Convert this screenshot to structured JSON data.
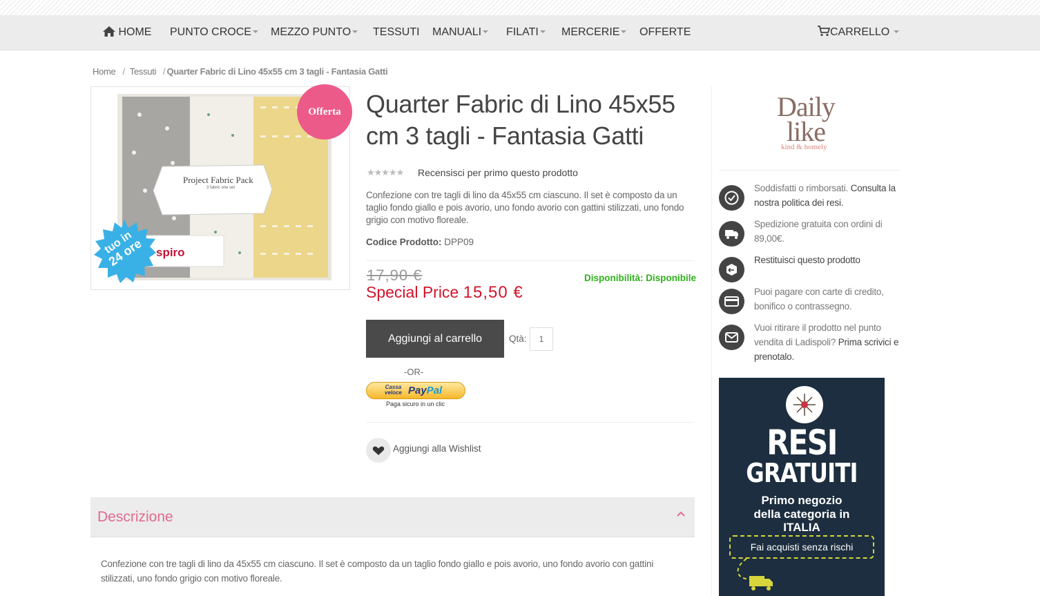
{
  "nav": {
    "home": "HOME",
    "items": [
      "PUNTO CROCE",
      "MEZZO PUNTO",
      "TESSUTI",
      "MANUALI",
      "FILATI",
      "MERCERIE",
      "OFFERTE"
    ],
    "cart": "CARRELLO"
  },
  "breadcrumb": {
    "home": "Home",
    "sep": "/",
    "category": "Tessuti",
    "current": "Quarter Fabric di Lino 45x55 cm 3 tagli - Fantasia Gatti"
  },
  "product": {
    "badge": "Offerta",
    "stamp_line1": "tuo in",
    "stamp_line2": "24 ore",
    "pack_title": "Project Fabric Pack",
    "pack_sub": "3 fabric one set",
    "pack_brand": "spiro",
    "title": "Quarter Fabric di Lino 45x55 cm 3 tagli - Fantasia Gatti",
    "stars": "★★★★★",
    "review_link": "Recensisci per primo questo prodotto",
    "short_description": "Confezione con tre tagli di lino da 45x55 cm ciascuno. Il set è composto da un taglio fondo giallo e pois avorio, uno fondo avorio con gattini stilizzati, uno fondo grigio con motivo floreale.",
    "sku_label": "Codice Prodotto:",
    "sku": "DPP09",
    "old_price": "17,90 €",
    "special_label": "Special Price",
    "special_price": "15,50 €",
    "availability_label": "Disponibilità:",
    "availability": "Disponibile",
    "add_to_cart": "Aggiungi al carrello",
    "qty_label": "Qtà:",
    "qty": "1",
    "or": "-OR-",
    "paypal_cv1": "Cassa",
    "paypal_cv2": "veloce",
    "paypal_a": "Pay",
    "paypal_b": "Pal",
    "paypal_sub": "Paga sicuro in un clic",
    "wishlist": "Aggiungi alla Wishlist"
  },
  "description": {
    "tab_label": "Descrizione",
    "text": "Confezione con tre tagli di lino da 45x55 cm ciascuno. Il set è composto da un taglio fondo giallo e pois avorio, uno fondo avorio con gattini stilizzati, uno fondo grigio con motivo floreale."
  },
  "sidebar": {
    "logo_line1": "Daily",
    "logo_line2": "like",
    "logo_tagline": "kind & homely",
    "features": [
      {
        "icon": "check-icon",
        "text": "Soddisfatti o rimborsati.",
        "link": " Consulta la nostra politica dei resi."
      },
      {
        "icon": "truck-icon",
        "text": "Spedizione gratuita con ordini di 89,00€.",
        "link": ""
      },
      {
        "icon": "return-box-icon",
        "text": "",
        "link": "Restituisci questo prodotto"
      },
      {
        "icon": "credit-card-icon",
        "text": "Puoi pagare con carte di credito, bonifico o contrassegno.",
        "link": ""
      },
      {
        "icon": "envelope-icon",
        "text": "Vuoi ritirare il prodotto nel punto vendita di Ladispoli?",
        "link": " Prima scrivici e prenotalo."
      }
    ],
    "banner": {
      "line1": "RESI",
      "line2": "GRATUITI",
      "sub1": "Primo negozio",
      "sub2": "della categoria in",
      "sub3": "ITALIA",
      "cta": "Fai acquisti senza rischi"
    }
  },
  "colors": {
    "accent_pink": "#e26a8f",
    "badge_pink": "#ec5a8a",
    "price_red": "#d2142b",
    "available_green": "#2fb11b",
    "button_dark": "#4a4a4a",
    "banner_navy": "#1c2e3f"
  }
}
